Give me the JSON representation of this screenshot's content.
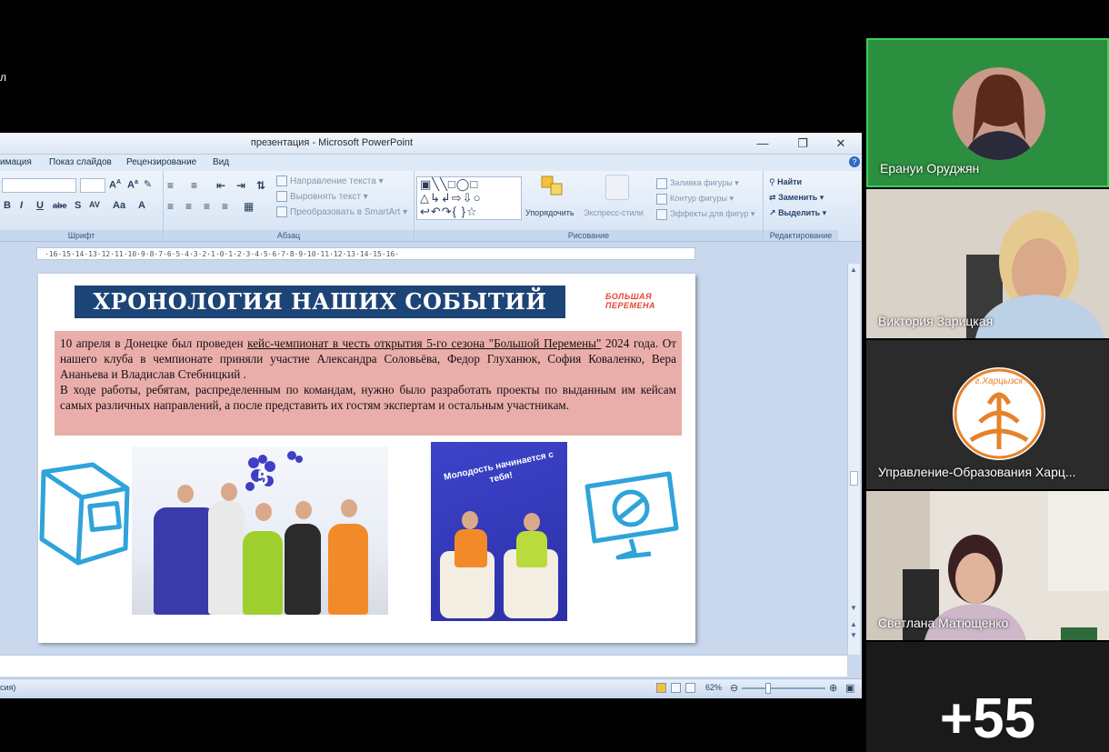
{
  "window": {
    "title": "презентация - Microsoft PowerPoint",
    "left_edge_char": "л"
  },
  "menu": [
    "имация",
    "Показ слайдов",
    "Рецензирование",
    "Вид"
  ],
  "ribbon": {
    "groups": {
      "font": "Шрифт",
      "paragraph": "Абзац",
      "drawing": "Рисование",
      "editing": "Редактирование"
    },
    "text_direction": "Направление текста",
    "align_text": "Выровнять текст",
    "smartart": "Преобразовать в SmartArt",
    "arrange": "Упорядочить",
    "quick_styles": "Экспресс-стили",
    "shape_fill": "Заливка фигуры",
    "shape_outline": "Контур фигуры",
    "shape_effects": "Эффекты для фигур",
    "find": "Найти",
    "replace": "Заменить",
    "select": "Выделить"
  },
  "ruler": "·16·15·14·13·12·11·10·9·8·7·6·5·4·3·2·1·0·1·2·3·4·5·6·7·8·9·10·11·12·13·14·15·16·",
  "slide": {
    "title": "ХРОНОЛОГИЯ НАШИХ СОБЫТИЙ",
    "logo_line1": "БОЛЬШАЯ",
    "logo_line2": "ПЕРЕМЕНА",
    "para1_prefix": "10 апреля в Донецке был проведен ",
    "para1_link": "кейс-чемпионат в честь открытия 5-го сезона \"Большой Перемены\"",
    "para1_rest": " 2024 года. От нашего клуба в чемпионате приняли участие Александра Соловьёва, Федор Глуханюк, София Коваленко, Вера Ананьева  и Владислав Стебницкий .",
    "para2": "В ходе работы, ребятам, распределенным по командам, нужно было разработать проекты по выданным им кейсам самых различных направлений, а после представить их гостям экспертам и остальным участникам.",
    "poster_text": "Молодость начинается с тебя!"
  },
  "status": {
    "left": "сия)",
    "zoom": "62%"
  },
  "participants": [
    {
      "name": "Ерануи Оруджян",
      "active": true
    },
    {
      "name": "Виктория Зарицкая",
      "active": false
    },
    {
      "name": "Управление-Образования Харц...",
      "active": false,
      "logo_text": "г.Харцызск"
    },
    {
      "name": "Светлана Матющенко",
      "active": false
    }
  ],
  "more_participants": "+55"
}
